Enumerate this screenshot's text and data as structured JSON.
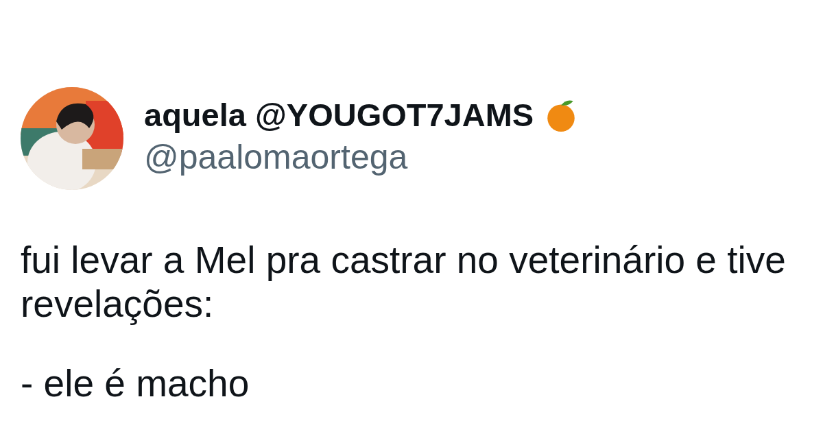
{
  "tweet": {
    "author": {
      "display_name": "aquela @YOUGOT7JAMS",
      "handle": "@paalomaortega"
    },
    "paragraphs": [
      [
        "fui levar a Mel pra castrar no veterinário e tive",
        "revelações:"
      ],
      [
        "- ele é macho"
      ]
    ]
  }
}
